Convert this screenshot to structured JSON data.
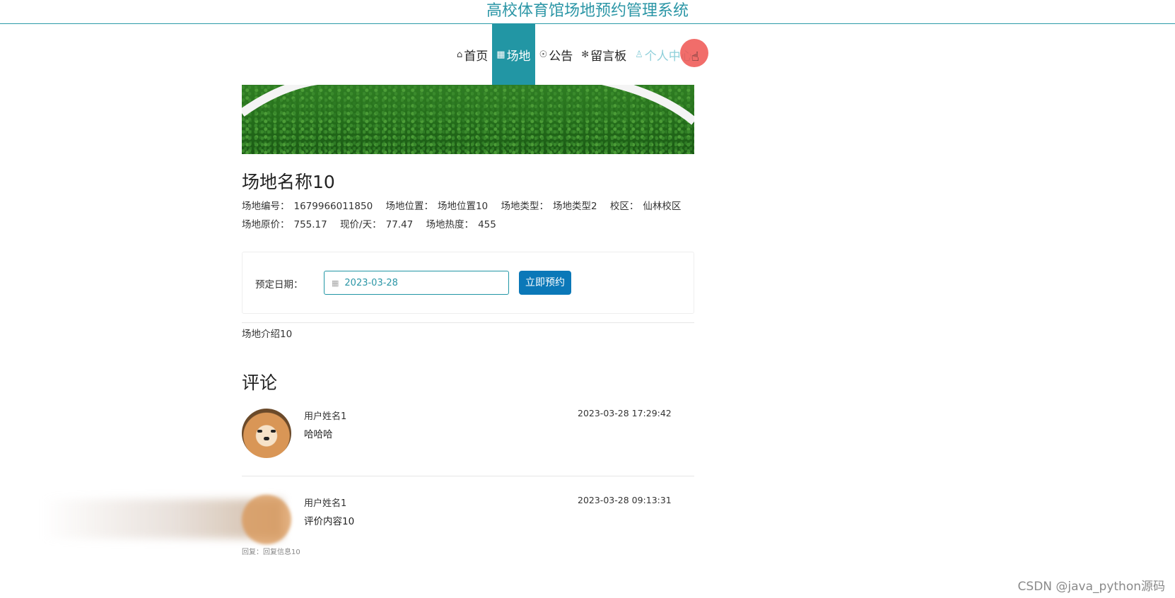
{
  "header": {
    "site_title": "高校体育馆场地预约管理系统"
  },
  "nav": {
    "items": [
      {
        "icon": "⌂",
        "label": "首页"
      },
      {
        "icon": "▦",
        "label": "场地"
      },
      {
        "icon": "☉",
        "label": "公告"
      },
      {
        "icon": "✻",
        "label": "留言板"
      },
      {
        "icon": "♙",
        "label": "个人中心"
      }
    ],
    "active_index": 1
  },
  "venue": {
    "name": "场地名称10",
    "number_label": "场地编号：",
    "number": "1679966011850",
    "location_label": "场地位置：",
    "location": "场地位置10",
    "type_label": "场地类型：",
    "type": "场地类型2",
    "campus_label": "校区：",
    "campus": "仙林校区",
    "orig_price_label": "场地原价：",
    "orig_price": "755.17",
    "price_label": "现价/天：",
    "price": "77.47",
    "heat_label": "场地热度：",
    "heat": "455",
    "intro": "场地介绍10"
  },
  "booking": {
    "date_label": "预定日期：",
    "date_value": "2023-03-28",
    "submit_label": "立即预约"
  },
  "comments": {
    "title": "评论",
    "items": [
      {
        "user": "用户姓名1",
        "text": "哈哈哈",
        "time": "2023-03-28 17:29:42"
      },
      {
        "user": "用户姓名1",
        "text": "评价内容10",
        "time": "2023-03-28 09:13:31",
        "reply": "回复：回复信息10"
      }
    ]
  },
  "watermark": "CSDN @java_python源码",
  "colors": {
    "accent": "#2296a4",
    "button": "#0b78b8"
  }
}
